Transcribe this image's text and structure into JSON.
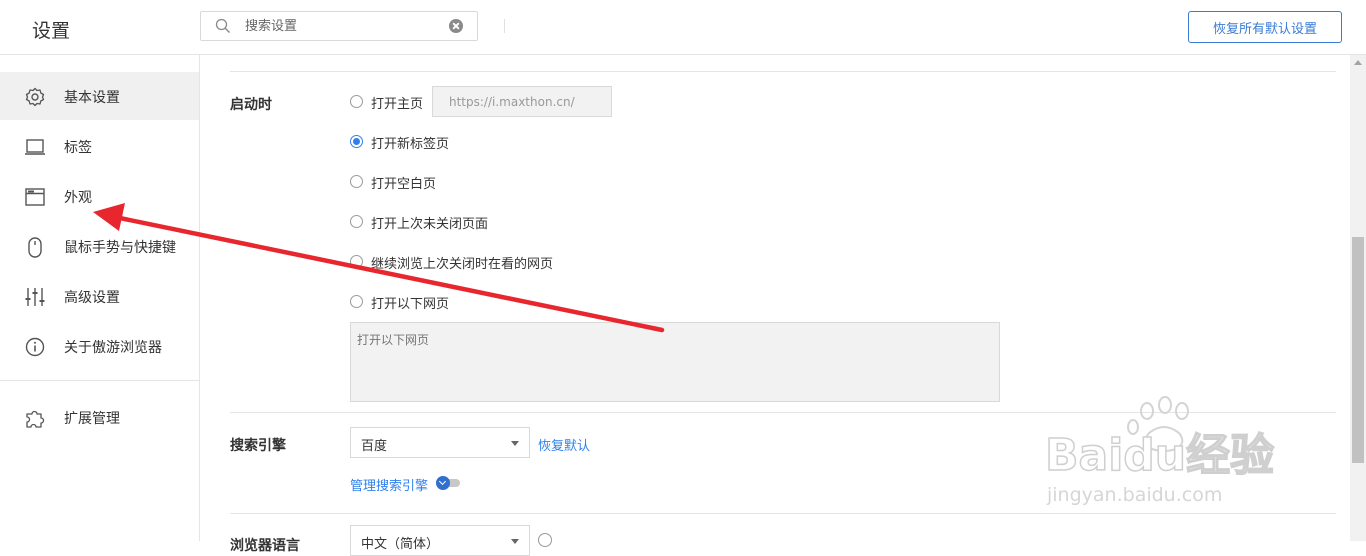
{
  "header": {
    "title": "设置",
    "search_placeholder": "搜索设置",
    "reset_all_label": "恢复所有默认设置"
  },
  "sidebar": {
    "items": [
      {
        "label": "基本设置",
        "icon": "gear-icon",
        "active": true
      },
      {
        "label": "标签",
        "icon": "tab-icon"
      },
      {
        "label": "外观",
        "icon": "window-icon"
      },
      {
        "label": "鼠标手势与快捷键",
        "icon": "mouse-icon"
      },
      {
        "label": "高级设置",
        "icon": "sliders-icon"
      },
      {
        "label": "关于傲游浏览器",
        "icon": "info-icon"
      },
      {
        "label": "扩展管理",
        "icon": "puzzle-icon"
      }
    ]
  },
  "startup": {
    "label": "启动时",
    "home_url": "https://i.maxthon.cn/",
    "options": [
      {
        "label": "打开主页",
        "selected": false
      },
      {
        "label": "打开新标签页",
        "selected": true
      },
      {
        "label": "打开空白页",
        "selected": false
      },
      {
        "label": "打开上次未关闭页面",
        "selected": false
      },
      {
        "label": "继续浏览上次关闭时在看的网页",
        "selected": false
      },
      {
        "label": "打开以下网页",
        "selected": false
      }
    ],
    "pages_placeholder": "打开以下网页"
  },
  "search_engine": {
    "label": "搜索引擎",
    "selected": "百度",
    "reset_label": "恢复默认",
    "manage_label": "管理搜索引擎"
  },
  "language": {
    "label": "浏览器语言",
    "selected": "中文（简体）"
  },
  "watermark": {
    "brand": "Baidu经验",
    "url": "jingyan.baidu.com"
  },
  "colors": {
    "accent": "#2f80ed",
    "arrow": "#e8262d",
    "active_bg": "#f0f0f0"
  }
}
